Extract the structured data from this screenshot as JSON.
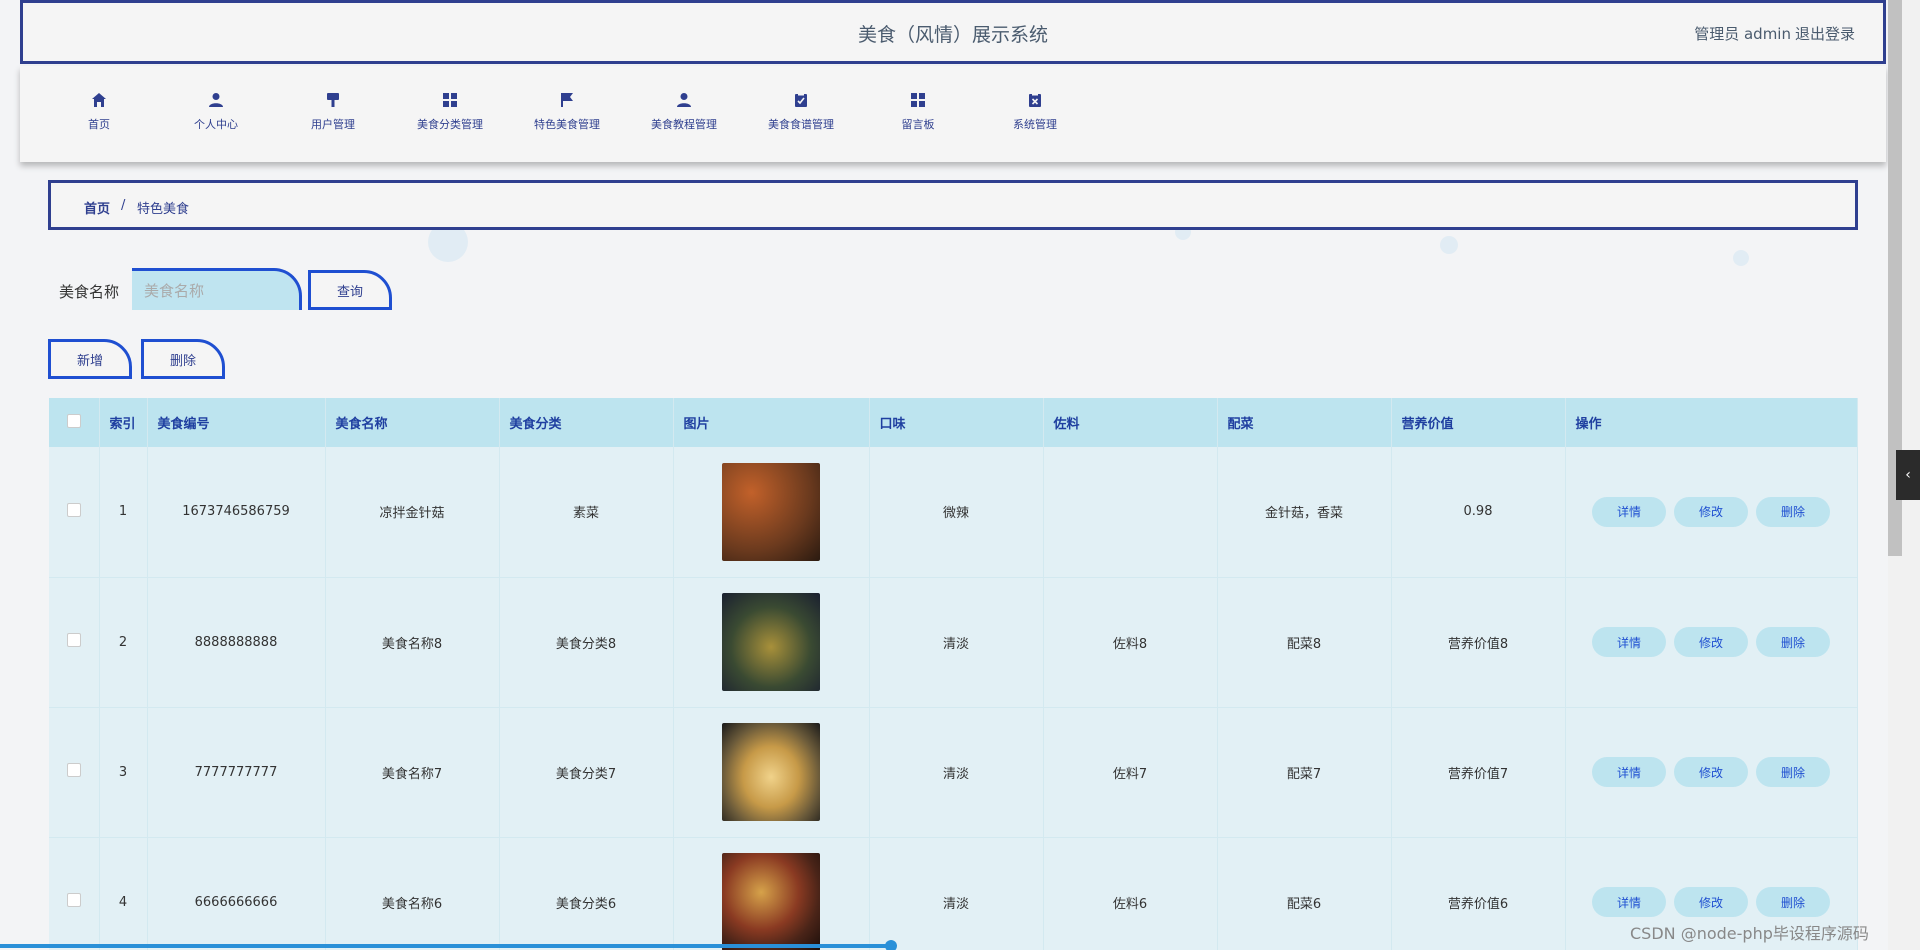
{
  "header": {
    "title": "美食（风情）展示系统",
    "user": "管理员 admin",
    "logout": "退出登录"
  },
  "nav": [
    {
      "label": "首页",
      "icon": "home-icon"
    },
    {
      "label": "个人中心",
      "icon": "user-icon"
    },
    {
      "label": "用户管理",
      "icon": "brush-icon"
    },
    {
      "label": "美食分类管理",
      "icon": "grid-icon"
    },
    {
      "label": "特色美食管理",
      "icon": "flag-icon"
    },
    {
      "label": "美食教程管理",
      "icon": "user-icon"
    },
    {
      "label": "美食食谱管理",
      "icon": "clipboard-icon"
    },
    {
      "label": "留言板",
      "icon": "grid-icon"
    },
    {
      "label": "系统管理",
      "icon": "close-box-icon"
    }
  ],
  "breadcrumb": {
    "home": "首页",
    "sep": "/",
    "current": "特色美食"
  },
  "search": {
    "label": "美食名称",
    "placeholder": "美食名称",
    "button": "查询"
  },
  "actions": {
    "add": "新增",
    "delete": "删除"
  },
  "table": {
    "columns": [
      "索引",
      "美食编号",
      "美食名称",
      "美食分类",
      "图片",
      "口味",
      "佐料",
      "配菜",
      "营养价值",
      "操作"
    ],
    "rows": [
      {
        "index": "1",
        "code": "1673746586759",
        "name": "凉拌金针菇",
        "category": "素菜",
        "taste": "微辣",
        "seasoning": "",
        "side": "金针菇，香菜",
        "nutrition": "0.98",
        "img": "#6b3a1e"
      },
      {
        "index": "2",
        "code": "8888888888",
        "name": "美食名称8",
        "category": "美食分类8",
        "taste": "清淡",
        "seasoning": "佐料8",
        "side": "配菜8",
        "nutrition": "营养价值8",
        "img": "#2e3a2a"
      },
      {
        "index": "3",
        "code": "7777777777",
        "name": "美食名称7",
        "category": "美食分类7",
        "taste": "清淡",
        "seasoning": "佐料7",
        "side": "配菜7",
        "nutrition": "营养价值7",
        "img": "#c79a48"
      },
      {
        "index": "4",
        "code": "6666666666",
        "name": "美食名称6",
        "category": "美食分类6",
        "taste": "清淡",
        "seasoning": "佐料6",
        "side": "配菜6",
        "nutrition": "营养价值6",
        "img": "#4a2418"
      }
    ],
    "ops": {
      "detail": "详情",
      "edit": "修改",
      "delete": "删除"
    }
  },
  "watermark": "CSDN @node-php毕设程序源码",
  "colors": {
    "primary": "#2f3f8f",
    "accent": "#1f4fd1",
    "header_bg": "#bde4ef",
    "row_bg": "#e2f0f5"
  }
}
